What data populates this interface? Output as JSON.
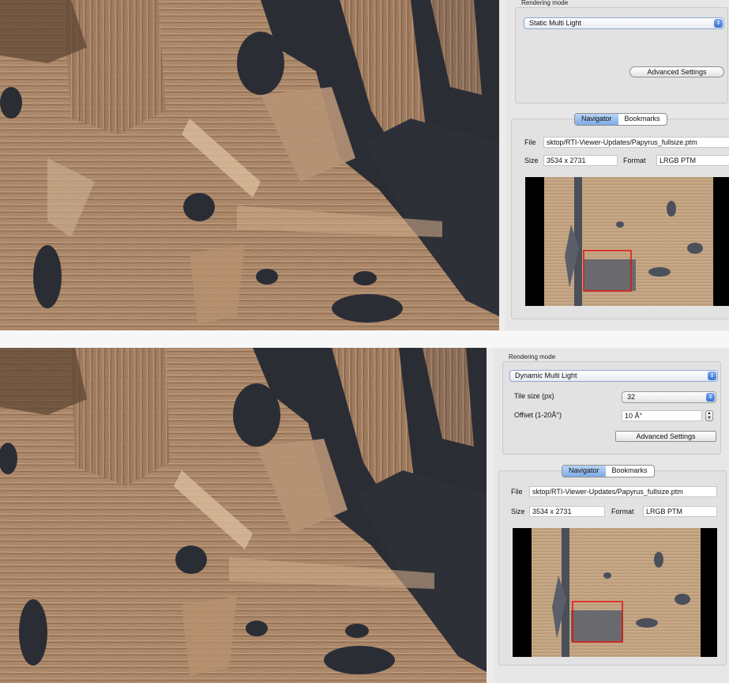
{
  "top": {
    "rendering_mode_label": "Rendering mode",
    "rendering_mode_value": "Static Multi Light",
    "advanced_settings": "Advanced Settings",
    "tabs": [
      "Navigator",
      "Bookmarks"
    ],
    "file_label": "File",
    "file_value": "sktop/RTI-Viewer-Updates/Papyrus_fullsize.ptm",
    "size_label": "Size",
    "size_value": "3534 x 2731",
    "format_label": "Format",
    "format_value": "LRGB PTM"
  },
  "bottom": {
    "rendering_mode_label": "Rendering mode",
    "rendering_mode_value": "Dynamic Multi Light",
    "tile_size_label": "Tile size (px)",
    "tile_size_value": "32",
    "offset_label": "Offset (1-20Å°)",
    "offset_value": "10 Å°",
    "advanced_settings": "Advanced Settings",
    "tabs": [
      "Navigator",
      "Bookmarks"
    ],
    "file_label": "File",
    "file_value": "sktop/RTI-Viewer-Updates/Papyrus_fullsize.ptm",
    "size_label": "Size",
    "size_value": "3534 x 2731",
    "format_label": "Format",
    "format_value": "LRGB PTM"
  },
  "colors": {
    "viewport_rect": "#e01010",
    "select_accent": "#3a72d3",
    "papyrus": "#a98567",
    "background_dark": "#2b2d35"
  }
}
